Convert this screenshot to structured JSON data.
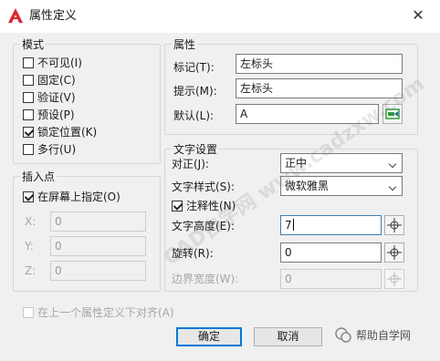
{
  "title": "属性定义",
  "mode": {
    "legend": "模式",
    "options": [
      {
        "label": "不可见(I)",
        "checked": false
      },
      {
        "label": "固定(C)",
        "checked": false
      },
      {
        "label": "验证(V)",
        "checked": false
      },
      {
        "label": "预设(P)",
        "checked": false
      },
      {
        "label": "锁定位置(K)",
        "checked": true
      },
      {
        "label": "多行(U)",
        "checked": false
      }
    ]
  },
  "insertion": {
    "legend": "插入点",
    "on_screen_label": "在屏幕上指定(O)",
    "on_screen_checked": true,
    "x_label": "X:",
    "x_value": "0",
    "y_label": "Y:",
    "y_value": "0",
    "z_label": "Z:",
    "z_value": "0"
  },
  "attribute": {
    "legend": "属性",
    "tag_label": "标记(T):",
    "tag_value": "左标头",
    "prompt_label": "提示(M):",
    "prompt_value": "左标头",
    "default_label": "默认(L):",
    "default_value": "A"
  },
  "text": {
    "legend": "文字设置",
    "justify_label": "对正(J):",
    "justify_value": "正中",
    "style_label": "文字样式(S):",
    "style_value": "微软雅黑",
    "annotative_label": "注释性(N)",
    "annotative_checked": true,
    "height_label": "文字高度(E):",
    "height_value": "7",
    "rotation_label": "旋转(R):",
    "rotation_value": "0",
    "boundary_label": "边界宽度(W):",
    "boundary_value": "0"
  },
  "align_below_label": "在上一个属性定义下对齐(A)",
  "ok_label": "确定",
  "cancel_label": "取消",
  "watermark": {
    "diag_text": "CAD自学网 www.cadzxw.com",
    "badge_text": "帮助自学网"
  },
  "colors": {
    "app_logo": "#d7282f",
    "default_border": "#0078d7",
    "field_icon": "#2e9a3a"
  }
}
